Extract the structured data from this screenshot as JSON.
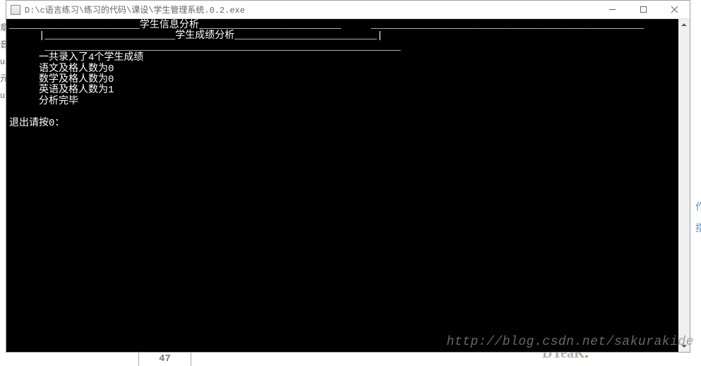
{
  "window": {
    "title": "D:\\c语言练习\\练习的代码\\课设\\学生管理系统.0.2.exe"
  },
  "console": {
    "header1": "______________________学生信息分析________________________     ______________________________________________",
    "header2": "     |______________________学生成绩分析________________________|",
    "header3": "      ____________________________________________________________",
    "line1": "     一共录入了4个学生成绩",
    "line2": "     语文及格人数为0",
    "line3": "     数学及格人数为0",
    "line4": "     英语及格人数为1",
    "line5": "     分析完毕",
    "line6": "",
    "exit": "退出请按0："
  },
  "background": {
    "left_chars": [
      "章",
      "音",
      "u",
      "元",
      "u"
    ],
    "right_chars": [
      "作",
      "指"
    ],
    "box_text": "47",
    "break_text": "DTeaK",
    "watermark": "http://blog.csdn.net/sakurakide"
  }
}
